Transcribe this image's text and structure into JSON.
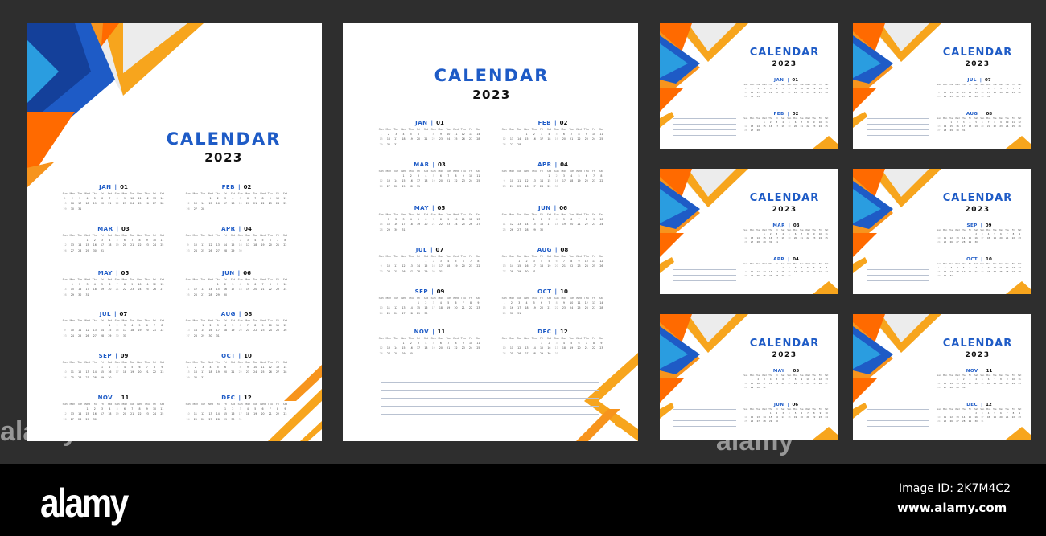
{
  "theme": {
    "accent_blue": "#1e5bc6",
    "accent_orange": "#f7941d",
    "deep_orange": "#ff6a00",
    "light_blue": "#2a9de0",
    "dark_blue": "#14409a"
  },
  "calendar": {
    "title": "CALENDAR",
    "year": "2023"
  },
  "weekday_headers": [
    "Sun",
    "Mon",
    "Tue",
    "Wed",
    "Thu",
    "Fri",
    "Sat",
    "Sun",
    "Mon",
    "Tue",
    "Wed",
    "Thu",
    "Fri",
    "Sat"
  ],
  "months": [
    {
      "name": "JAN",
      "num": "01",
      "start": 0,
      "days": 31
    },
    {
      "name": "FEB",
      "num": "02",
      "start": 3,
      "days": 28
    },
    {
      "name": "MAR",
      "num": "03",
      "start": 3,
      "days": 31
    },
    {
      "name": "APR",
      "num": "04",
      "start": 6,
      "days": 30
    },
    {
      "name": "MAY",
      "num": "05",
      "start": 1,
      "days": 31
    },
    {
      "name": "JUN",
      "num": "06",
      "start": 4,
      "days": 30
    },
    {
      "name": "JUL",
      "num": "07",
      "start": 6,
      "days": 31
    },
    {
      "name": "AUG",
      "num": "08",
      "start": 2,
      "days": 31
    },
    {
      "name": "SEP",
      "num": "09",
      "start": 5,
      "days": 30
    },
    {
      "name": "OCT",
      "num": "10",
      "start": 0,
      "days": 31
    },
    {
      "name": "NOV",
      "num": "11",
      "start": 3,
      "days": 30
    },
    {
      "name": "DEC",
      "num": "12",
      "start": 5,
      "days": 31
    }
  ],
  "landscape_pages": [
    {
      "months": [
        0,
        1
      ]
    },
    {
      "months": [
        6,
        7
      ]
    },
    {
      "months": [
        2,
        3
      ]
    },
    {
      "months": [
        8,
        9
      ]
    },
    {
      "months": [
        4,
        5
      ]
    },
    {
      "months": [
        10,
        11
      ]
    }
  ],
  "footer": {
    "logo": "alamy",
    "image_id": "Image ID: 2K7M4C2",
    "url": "www.alamy.com"
  },
  "watermark": "alamy"
}
